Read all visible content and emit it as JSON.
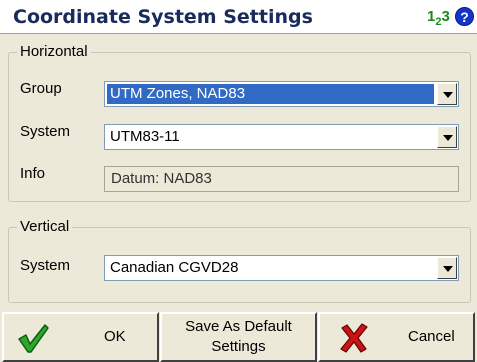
{
  "title": "Coordinate System Settings",
  "icons": {
    "units": {
      "main": "1",
      "sub": "2",
      "tail": "3"
    },
    "help": "?"
  },
  "horizontal": {
    "legend": "Horizontal",
    "group_label": "Group",
    "group_value": "UTM Zones, NAD83",
    "system_label": "System",
    "system_value": "UTM83-11",
    "info_label": "Info",
    "info_value": "Datum: NAD83"
  },
  "vertical": {
    "legend": "Vertical",
    "system_label": "System",
    "system_value": "Canadian CGVD28"
  },
  "buttons": {
    "ok": "OK",
    "save_default_line1": "Save As Default",
    "save_default_line2": "Settings",
    "cancel": "Cancel"
  },
  "colors": {
    "selection": "#316ac5",
    "check_green": "#2fa52f",
    "cancel_red": "#c81414"
  }
}
